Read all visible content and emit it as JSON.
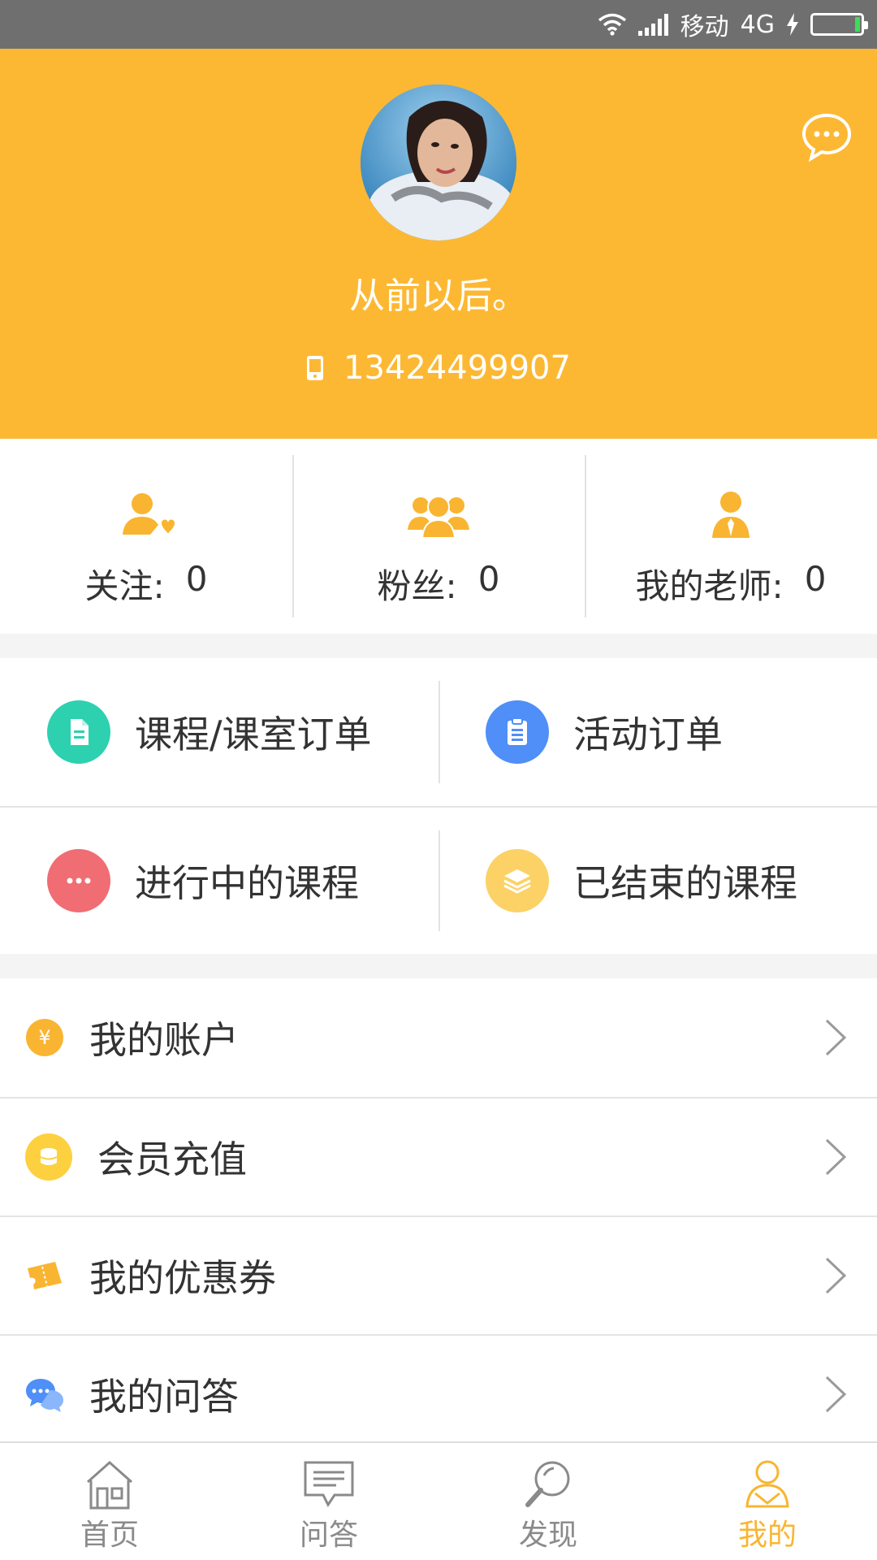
{
  "status_bar": {
    "carrier": "移动",
    "network": "4G"
  },
  "profile": {
    "nickname": "从前以后。",
    "phone": "13424499907"
  },
  "stats": [
    {
      "label": "关注:",
      "value": "0",
      "icon": "follow-icon"
    },
    {
      "label": "粉丝:",
      "value": "0",
      "icon": "fans-icon"
    },
    {
      "label": "我的老师:",
      "value": "0",
      "icon": "teacher-icon"
    }
  ],
  "orders": [
    {
      "label": "课程/课室订单",
      "icon": "document-icon",
      "color": "#2dd1b0"
    },
    {
      "label": "活动订单",
      "icon": "clipboard-icon",
      "color": "#4f8ff7"
    },
    {
      "label": "进行中的课程",
      "icon": "more-dots-icon",
      "color": "#f06d73"
    },
    {
      "label": "已结束的课程",
      "icon": "layers-icon",
      "color": "#fcd266"
    }
  ],
  "menu": [
    {
      "label": "我的账户",
      "icon": "yen-coin-icon"
    },
    {
      "label": "会员充值",
      "icon": "coins-icon"
    },
    {
      "label": "我的优惠券",
      "icon": "coupon-icon"
    },
    {
      "label": "我的问答",
      "icon": "chat-bubbles-icon"
    }
  ],
  "tabs": [
    {
      "label": "首页",
      "icon": "home-icon"
    },
    {
      "label": "问答",
      "icon": "qa-icon"
    },
    {
      "label": "发现",
      "icon": "discover-icon"
    },
    {
      "label": "我的",
      "icon": "profile-icon",
      "active": true
    }
  ],
  "colors": {
    "header": "#fdb833",
    "accent": "#f9b531",
    "status_bar": "#6f6f6f"
  }
}
